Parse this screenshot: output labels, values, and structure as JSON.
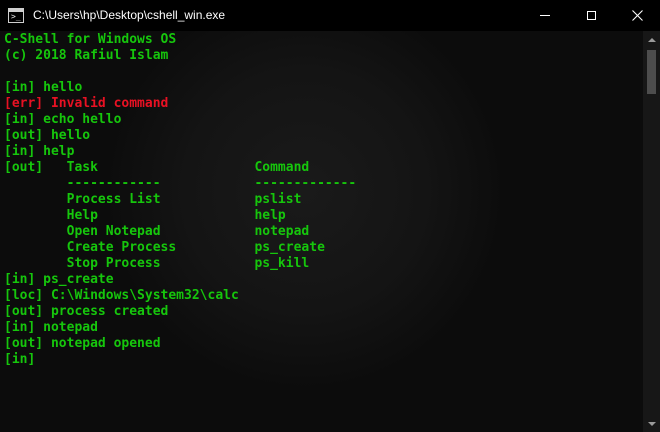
{
  "window": {
    "title": "C:\\Users\\hp\\Desktop\\cshell_win.exe",
    "icon": "console-app-icon",
    "controls": {
      "minimize": "minimize-icon",
      "maximize": "maximize-icon",
      "close": "close-icon"
    }
  },
  "colors": {
    "background": "#0c0c0c",
    "text": "#16c60c",
    "error": "#e81123"
  },
  "console": {
    "lines": [
      {
        "text": "C-Shell for Windows OS",
        "type": "out"
      },
      {
        "text": "(c) 2018 Rafiul Islam",
        "type": "out"
      },
      {
        "text": "",
        "type": "out"
      },
      {
        "text": "[in] hello",
        "type": "out"
      },
      {
        "text": "[err] Invalid command",
        "type": "err"
      },
      {
        "text": "[in] echo hello",
        "type": "out"
      },
      {
        "text": "[out] hello",
        "type": "out"
      },
      {
        "text": "[in] help",
        "type": "out"
      },
      {
        "text": "[out]   Task                    Command",
        "type": "out"
      },
      {
        "text": "        ------------            -------------",
        "type": "out"
      },
      {
        "text": "        Process List            pslist",
        "type": "out"
      },
      {
        "text": "        Help                    help",
        "type": "out"
      },
      {
        "text": "        Open Notepad            notepad",
        "type": "out"
      },
      {
        "text": "        Create Process          ps_create",
        "type": "out"
      },
      {
        "text": "        Stop Process            ps_kill",
        "type": "out"
      },
      {
        "text": "[in] ps_create",
        "type": "out"
      },
      {
        "text": "[loc] C:\\Windows\\System32\\calc",
        "type": "out"
      },
      {
        "text": "[out] process created",
        "type": "out"
      },
      {
        "text": "[in] notepad",
        "type": "out"
      },
      {
        "text": "[out] notepad opened",
        "type": "out"
      },
      {
        "text": "[in]",
        "type": "out"
      }
    ]
  }
}
